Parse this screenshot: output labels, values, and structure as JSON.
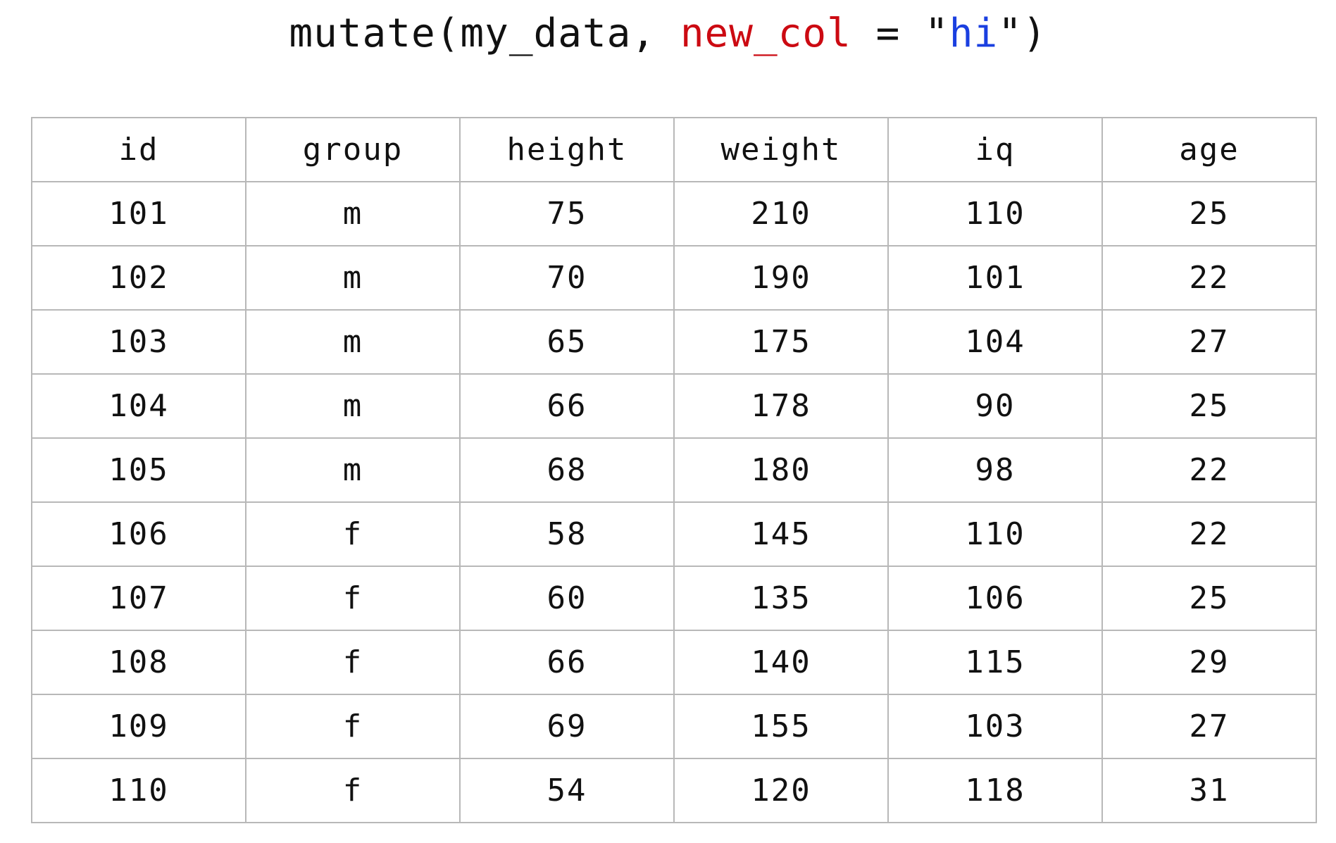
{
  "code": {
    "func": "mutate",
    "open_paren": "(",
    "data_arg": "my_data",
    "comma": ", ",
    "new_arg": "new_col",
    "equals": " = ",
    "quote_open": "\"",
    "string_value": "hi",
    "quote_close": "\"",
    "close_paren": ")",
    "colors": {
      "argument": "#cc0a12",
      "string": "#1a3fe0",
      "text": "#111111"
    }
  },
  "table": {
    "columns": [
      "id",
      "group",
      "height",
      "weight",
      "iq",
      "age"
    ],
    "rows": [
      [
        "101",
        "m",
        "75",
        "210",
        "110",
        "25"
      ],
      [
        "102",
        "m",
        "70",
        "190",
        "101",
        "22"
      ],
      [
        "103",
        "m",
        "65",
        "175",
        "104",
        "27"
      ],
      [
        "104",
        "m",
        "66",
        "178",
        "90",
        "25"
      ],
      [
        "105",
        "m",
        "68",
        "180",
        "98",
        "22"
      ],
      [
        "106",
        "f",
        "58",
        "145",
        "110",
        "22"
      ],
      [
        "107",
        "f",
        "60",
        "135",
        "106",
        "25"
      ],
      [
        "108",
        "f",
        "66",
        "140",
        "115",
        "29"
      ],
      [
        "109",
        "f",
        "69",
        "155",
        "103",
        "27"
      ],
      [
        "110",
        "f",
        "54",
        "120",
        "118",
        "31"
      ]
    ]
  }
}
